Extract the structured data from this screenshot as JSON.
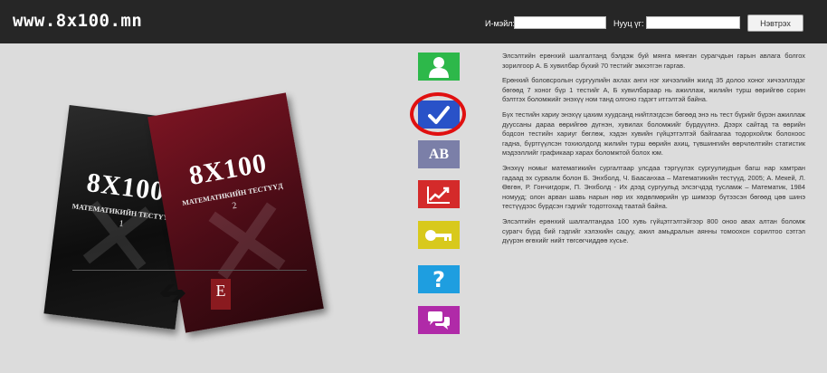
{
  "header": {
    "site_name": "www.8x100.mn",
    "email_label": "И-мэйл:",
    "password_label": "Нууц үг:",
    "email_value": "",
    "password_value": "",
    "login_button": "Нэвтрэх"
  },
  "books": [
    {
      "title": "8X100",
      "subtitle": "МАТЕМАТИКИЙН ТЕСТҮҮД",
      "volume": "1"
    },
    {
      "title": "8X100",
      "subtitle": "МАТЕМАТИКИЙН ТЕСТҮҮД",
      "volume": "2"
    }
  ],
  "sidebar_buttons": [
    {
      "name": "user",
      "label": "",
      "color": "#2db84a",
      "icon": "user-icon"
    },
    {
      "name": "check",
      "label": "",
      "color": "#2952c8",
      "icon": "checkmark-icon"
    },
    {
      "name": "ab",
      "label": "AB",
      "color": "#7b7fa8",
      "icon": "ab-icon"
    },
    {
      "name": "chart",
      "label": "",
      "color": "#d42a2a",
      "icon": "chart-icon"
    },
    {
      "name": "key",
      "label": "",
      "color": "#d8c91c",
      "icon": "key-icon"
    },
    {
      "name": "help",
      "label": "?",
      "color": "#1e9ee0",
      "icon": "question-icon"
    },
    {
      "name": "chat",
      "label": "",
      "color": "#b02aa8",
      "icon": "chat-icon"
    }
  ],
  "paragraphs": [
    "Элсэлтийн ерөнхий шалгалтанд бэлдэж буй мянга мянган сурагчдын гарын авлага болгох зорилгоор А. Б хувилбар бүхий 70 тестийг эмхэтгэн гаргав.",
    "Ерөнхий боловсролын сургуулийн ахлах анги нэг хичээлийн жилд 35 долоо хоног хичээллэдэг бөгөөд 7 хоног бүр 1 тестийг А, Б хувилбараар нь ажиллаж, жилийн турш өөрийгөө сорин бэлтгэх боломжийг энэхүү ном танд олгоно гэдэгт итгэлтэй байна.",
    "Бүх тестийн хариу энэхүү цахим хуудсанд нийтлэгдсэн бөгөөд энэ нь тест бүрийг бүрэн ажиллаж дууссаны дараа өөрийгөө дүгнэн, хувилах боломжийг бүрдүүлнэ. Дээрх сайтад та өөрийн бодсон тестийн хариуг бөглөж, хэдэн хувийн гүйцэтгэлтэй байгаагаа тодорхойлж болохоос гадна, бүртгүүлсэн тохиолдолд жилийн турш өөрийн ахиц, түвшингийн өөрчлөлтийн статистик мэдээллийг графикаар харах боломжтой болох юм.",
    "Энэхүү номыг математикийн сургалтаар улсдаа тэргүүлэх сургуулиудын багш нар хамтран гадаад эх сурвалж болон Б. Энхболд, Ч. Баасанхаа – Математикийн тестүүд, 2005; А. Мекей, Л. Өвгөн, Р. Гончигдорж, П. Энхболд - Их дээд сургуульд элсэгчдэд тусламж – Математик, 1984 номууд; олон арван шавь нарын нөр их хөдөлмөрийн үр шимээр бүтээсэн бөгөөд цөө шинэ тестүүдээс бүрдсэн гэдгийг тодотгохад таатай байна.",
    "Элсэлтийн ерөнхий шалгалтандаа 100 хувь гүйцэтгэлтэйгээр 800 оноо авах алтан боломж сурагч бүрд бий гэдгийг хэлэхийн сацуу, ажил амьдралын аянны томоохон сорилтоо сэтгэл дүүрэн өгөхийг нийт төгсөгчиддөө хүсье."
  ]
}
